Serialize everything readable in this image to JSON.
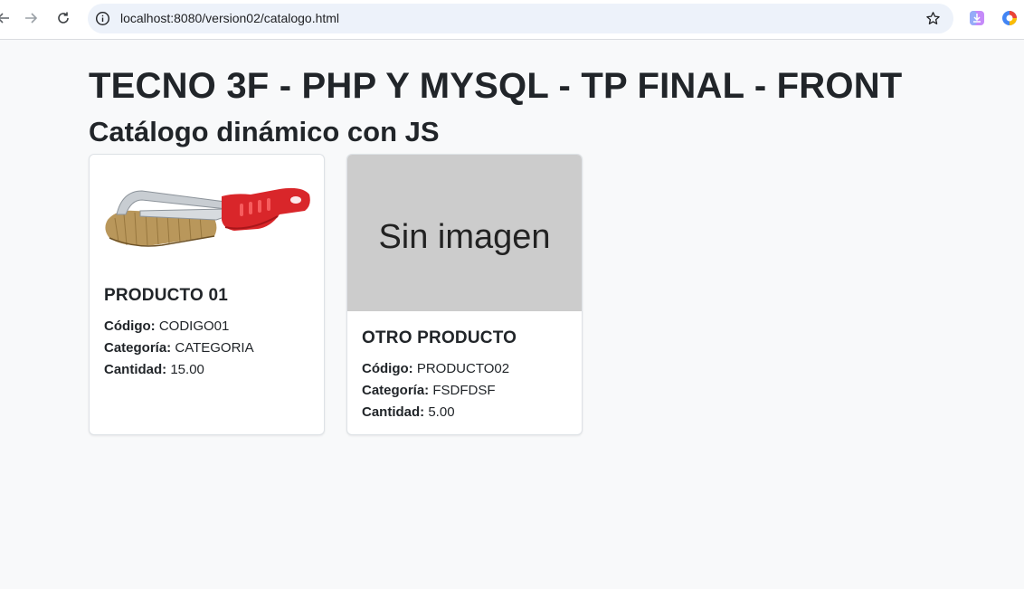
{
  "browser": {
    "url": "localhost:8080/version02/catalogo.html"
  },
  "page": {
    "title": "TECNO 3F - PHP Y MYSQL - TP FINAL - FRONT",
    "subtitle": "Catálogo dinámico con JS"
  },
  "labels": {
    "codigo": "Código:",
    "categoria": "Categoría:",
    "cantidad": "Cantidad:"
  },
  "products": [
    {
      "name": "PRODUCTO 01",
      "codigo": "CODIGO01",
      "categoria": "CATEGORIA",
      "cantidad": "15.00"
    },
    {
      "name": "OTRO PRODUCTO",
      "codigo": "PRODUCTO02",
      "categoria": "FSDFDSF",
      "cantidad": "5.00",
      "image_text": "Sin imagen"
    }
  ]
}
